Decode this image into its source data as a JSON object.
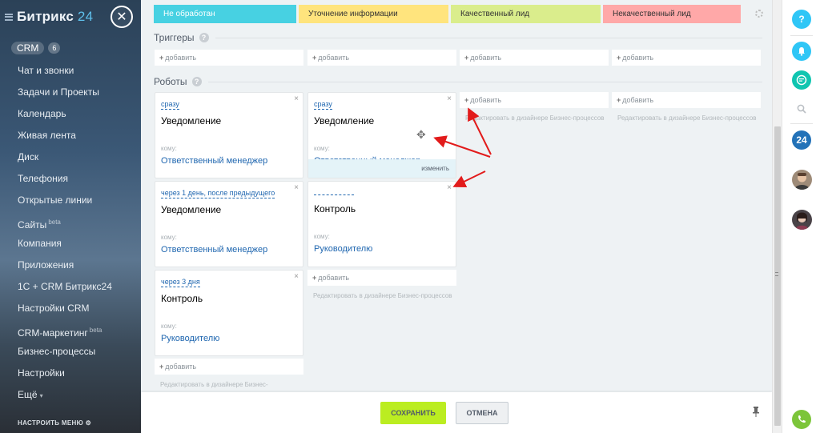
{
  "sidebar": {
    "logo_text": "Битрикс",
    "logo_num": "24",
    "crm_label": "CRM",
    "crm_count": "6",
    "items": [
      {
        "label": "Чат и звонки",
        "badge": ""
      },
      {
        "label": "Задачи и Проекты",
        "badge": ""
      },
      {
        "label": "Календарь",
        "badge": ""
      },
      {
        "label": "Живая лента",
        "badge": ""
      },
      {
        "label": "Диск",
        "badge": ""
      },
      {
        "label": "Телефония",
        "badge": ""
      },
      {
        "label": "Открытые линии",
        "badge": ""
      },
      {
        "label": "Сайты",
        "badge": "beta"
      },
      {
        "label": "Компания",
        "badge": ""
      },
      {
        "label": "Приложения",
        "badge": ""
      },
      {
        "label": "1С + CRM Битрикс24",
        "badge": ""
      },
      {
        "label": "Настройки CRM",
        "badge": ""
      },
      {
        "label": "CRM-маркетинг",
        "badge": "beta"
      },
      {
        "label": "Бизнес-процессы",
        "badge": ""
      },
      {
        "label": "Настройки",
        "badge": ""
      },
      {
        "label": "Ещё",
        "badge": ""
      }
    ],
    "more_chevron": "▾",
    "footer": "НАСТРОИТЬ МЕНЮ"
  },
  "stages": [
    {
      "label": "Не обработан",
      "color": "#47d1e2",
      "text_color": "#ffffff"
    },
    {
      "label": "Уточнение информации",
      "color": "#ffe47d",
      "text_color": "#333333"
    },
    {
      "label": "Качественный лид",
      "color": "#daed8c",
      "text_color": "#333333"
    },
    {
      "label": "Некачественный лид",
      "color": "#ffa8a8",
      "text_color": "#333333"
    }
  ],
  "triggers": {
    "title": "Триггеры",
    "help": "?",
    "add_labels": [
      "добавить",
      "добавить",
      "добавить",
      "добавить"
    ]
  },
  "robots": {
    "title": "Роботы",
    "help": "?",
    "to_label": "кому:",
    "close_glyph": "×",
    "col1": {
      "cards": [
        {
          "when": "сразу",
          "title": "Уведомление",
          "to": "Ответственный менеджер"
        },
        {
          "when": "через 1 день, после предыдущего",
          "title": "Уведомление",
          "to": "Ответственный менеджер"
        },
        {
          "when": "через 3 дня",
          "title": "Контроль",
          "to": "Руководителю"
        }
      ],
      "add_label": "добавить",
      "hint": "Редактировать в дизайнере Бизнес-"
    },
    "col2": {
      "cards": [
        {
          "when": "сразу",
          "title": "Уведомление",
          "to": "Ответственный менеджер",
          "edit": "изменить"
        },
        {
          "when": "",
          "title": "Контроль",
          "to": "Руководителю"
        }
      ],
      "add_label": "добавить",
      "hint": "Редактировать в дизайнере Бизнес-процессов"
    },
    "col3": {
      "add_label": "добавить",
      "hint": "Редактировать в дизайнере Бизнес-процессов"
    },
    "col4": {
      "add_label": "добавить",
      "hint": "Редактировать в дизайнере Бизнес-процессов"
    }
  },
  "actions": {
    "save": "СОХРАНИТЬ",
    "cancel": "ОТМЕНА"
  },
  "rightbar": {
    "help": "?",
    "b24": "24"
  },
  "colors": {
    "accent_blue": "#2067b0",
    "save_green": "#bbed21",
    "annotation_red": "#e21b1b"
  }
}
